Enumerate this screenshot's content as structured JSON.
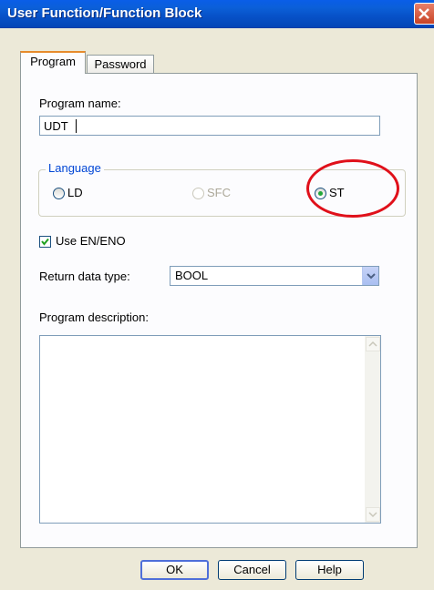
{
  "window": {
    "title": "User Function/Function Block"
  },
  "tabs": [
    {
      "label": "Program",
      "active": true
    },
    {
      "label": "Password",
      "active": false
    }
  ],
  "program_name": {
    "label": "Program name:",
    "value": "UDT"
  },
  "language": {
    "legend": "Language",
    "options": [
      {
        "label": "LD",
        "selected": false,
        "enabled": true
      },
      {
        "label": "SFC",
        "selected": false,
        "enabled": false
      },
      {
        "label": "ST",
        "selected": true,
        "enabled": true
      }
    ]
  },
  "use_en_eno": {
    "label": "Use EN/ENO",
    "checked": true
  },
  "return_type": {
    "label": "Return data type:",
    "value": "BOOL"
  },
  "description": {
    "label": "Program description:",
    "value": ""
  },
  "buttons": {
    "ok": "OK",
    "cancel": "Cancel",
    "help": "Help"
  },
  "colors": {
    "titlebar": "#0a5ee8",
    "annotation": "#e0101a",
    "accent_tab": "#e68b2c",
    "group_legend": "#0046d5"
  },
  "icons": {
    "close": "close-icon",
    "dropdown": "chevron-down-icon",
    "check": "check-icon"
  }
}
